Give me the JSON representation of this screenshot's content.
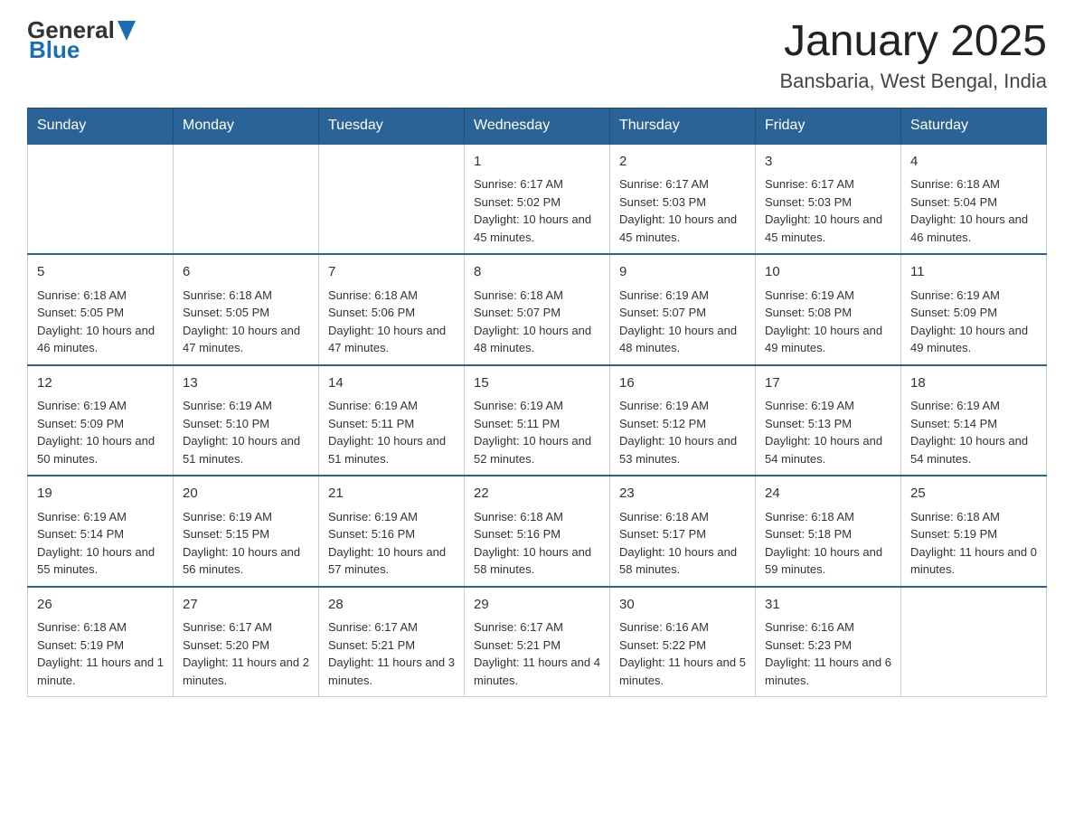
{
  "header": {
    "logo": {
      "general": "General",
      "blue": "Blue"
    },
    "title": "January 2025",
    "location": "Bansbaria, West Bengal, India"
  },
  "days_of_week": [
    "Sunday",
    "Monday",
    "Tuesday",
    "Wednesday",
    "Thursday",
    "Friday",
    "Saturday"
  ],
  "weeks": [
    [
      {
        "day": "",
        "info": ""
      },
      {
        "day": "",
        "info": ""
      },
      {
        "day": "",
        "info": ""
      },
      {
        "day": "1",
        "info": "Sunrise: 6:17 AM\nSunset: 5:02 PM\nDaylight: 10 hours and 45 minutes."
      },
      {
        "day": "2",
        "info": "Sunrise: 6:17 AM\nSunset: 5:03 PM\nDaylight: 10 hours and 45 minutes."
      },
      {
        "day": "3",
        "info": "Sunrise: 6:17 AM\nSunset: 5:03 PM\nDaylight: 10 hours and 45 minutes."
      },
      {
        "day": "4",
        "info": "Sunrise: 6:18 AM\nSunset: 5:04 PM\nDaylight: 10 hours and 46 minutes."
      }
    ],
    [
      {
        "day": "5",
        "info": "Sunrise: 6:18 AM\nSunset: 5:05 PM\nDaylight: 10 hours and 46 minutes."
      },
      {
        "day": "6",
        "info": "Sunrise: 6:18 AM\nSunset: 5:05 PM\nDaylight: 10 hours and 47 minutes."
      },
      {
        "day": "7",
        "info": "Sunrise: 6:18 AM\nSunset: 5:06 PM\nDaylight: 10 hours and 47 minutes."
      },
      {
        "day": "8",
        "info": "Sunrise: 6:18 AM\nSunset: 5:07 PM\nDaylight: 10 hours and 48 minutes."
      },
      {
        "day": "9",
        "info": "Sunrise: 6:19 AM\nSunset: 5:07 PM\nDaylight: 10 hours and 48 minutes."
      },
      {
        "day": "10",
        "info": "Sunrise: 6:19 AM\nSunset: 5:08 PM\nDaylight: 10 hours and 49 minutes."
      },
      {
        "day": "11",
        "info": "Sunrise: 6:19 AM\nSunset: 5:09 PM\nDaylight: 10 hours and 49 minutes."
      }
    ],
    [
      {
        "day": "12",
        "info": "Sunrise: 6:19 AM\nSunset: 5:09 PM\nDaylight: 10 hours and 50 minutes."
      },
      {
        "day": "13",
        "info": "Sunrise: 6:19 AM\nSunset: 5:10 PM\nDaylight: 10 hours and 51 minutes."
      },
      {
        "day": "14",
        "info": "Sunrise: 6:19 AM\nSunset: 5:11 PM\nDaylight: 10 hours and 51 minutes."
      },
      {
        "day": "15",
        "info": "Sunrise: 6:19 AM\nSunset: 5:11 PM\nDaylight: 10 hours and 52 minutes."
      },
      {
        "day": "16",
        "info": "Sunrise: 6:19 AM\nSunset: 5:12 PM\nDaylight: 10 hours and 53 minutes."
      },
      {
        "day": "17",
        "info": "Sunrise: 6:19 AM\nSunset: 5:13 PM\nDaylight: 10 hours and 54 minutes."
      },
      {
        "day": "18",
        "info": "Sunrise: 6:19 AM\nSunset: 5:14 PM\nDaylight: 10 hours and 54 minutes."
      }
    ],
    [
      {
        "day": "19",
        "info": "Sunrise: 6:19 AM\nSunset: 5:14 PM\nDaylight: 10 hours and 55 minutes."
      },
      {
        "day": "20",
        "info": "Sunrise: 6:19 AM\nSunset: 5:15 PM\nDaylight: 10 hours and 56 minutes."
      },
      {
        "day": "21",
        "info": "Sunrise: 6:19 AM\nSunset: 5:16 PM\nDaylight: 10 hours and 57 minutes."
      },
      {
        "day": "22",
        "info": "Sunrise: 6:18 AM\nSunset: 5:16 PM\nDaylight: 10 hours and 58 minutes."
      },
      {
        "day": "23",
        "info": "Sunrise: 6:18 AM\nSunset: 5:17 PM\nDaylight: 10 hours and 58 minutes."
      },
      {
        "day": "24",
        "info": "Sunrise: 6:18 AM\nSunset: 5:18 PM\nDaylight: 10 hours and 59 minutes."
      },
      {
        "day": "25",
        "info": "Sunrise: 6:18 AM\nSunset: 5:19 PM\nDaylight: 11 hours and 0 minutes."
      }
    ],
    [
      {
        "day": "26",
        "info": "Sunrise: 6:18 AM\nSunset: 5:19 PM\nDaylight: 11 hours and 1 minute."
      },
      {
        "day": "27",
        "info": "Sunrise: 6:17 AM\nSunset: 5:20 PM\nDaylight: 11 hours and 2 minutes."
      },
      {
        "day": "28",
        "info": "Sunrise: 6:17 AM\nSunset: 5:21 PM\nDaylight: 11 hours and 3 minutes."
      },
      {
        "day": "29",
        "info": "Sunrise: 6:17 AM\nSunset: 5:21 PM\nDaylight: 11 hours and 4 minutes."
      },
      {
        "day": "30",
        "info": "Sunrise: 6:16 AM\nSunset: 5:22 PM\nDaylight: 11 hours and 5 minutes."
      },
      {
        "day": "31",
        "info": "Sunrise: 6:16 AM\nSunset: 5:23 PM\nDaylight: 11 hours and 6 minutes."
      },
      {
        "day": "",
        "info": ""
      }
    ]
  ]
}
